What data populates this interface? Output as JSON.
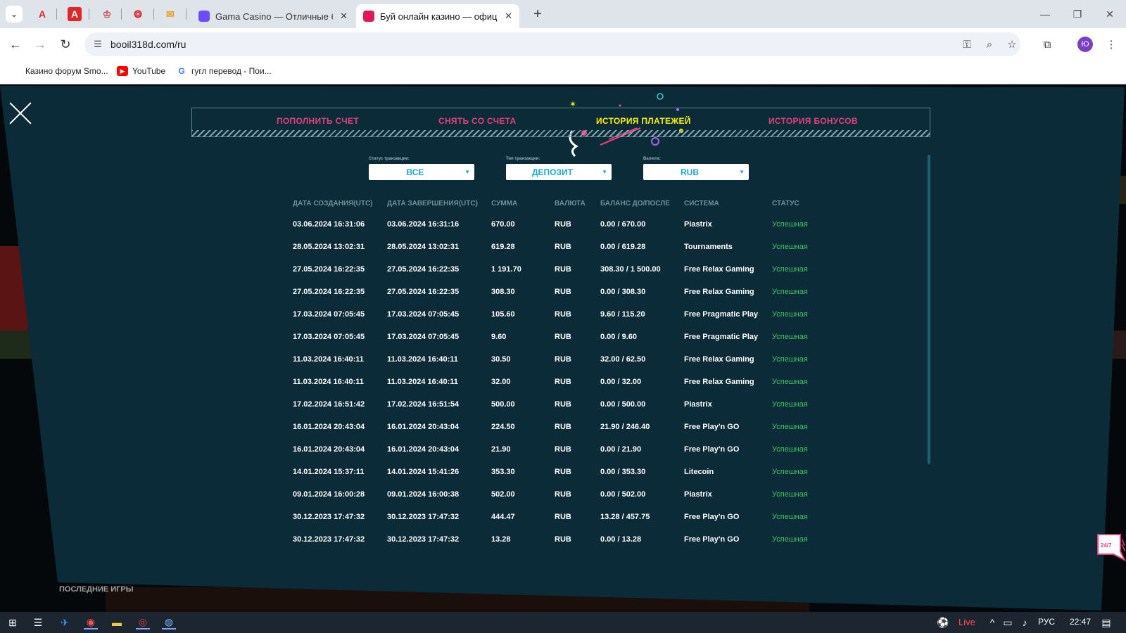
{
  "browser": {
    "pinned": [
      {
        "name": "acrobat",
        "glyph": "A",
        "color": "#e0262b"
      },
      {
        "name": "adobe",
        "glyph": "A",
        "color": "#ffffff",
        "bg": "#e0262b"
      },
      {
        "name": "crown",
        "glyph": "♔",
        "color": "#d7464c"
      },
      {
        "name": "gear",
        "glyph": "❂",
        "color": "#e0262b"
      },
      {
        "name": "mail",
        "glyph": "✉",
        "color": "#e8a21a"
      }
    ],
    "tabs": [
      {
        "title": "Gama Casino — Отличные бо",
        "fav_color": "#6d4cff",
        "close": "✕"
      },
      {
        "title": "Буй онлайн казино — официа",
        "fav_color": "#e0195b",
        "close": "✕"
      }
    ],
    "new_tab": "+",
    "window": {
      "minimize": "—",
      "restore": "❐",
      "close": "✕"
    },
    "nav": {
      "back": "←",
      "forward": "→",
      "reload": "↻"
    },
    "url": "booil318d.com/ru",
    "profile_letter": "Ю",
    "bookmarks": [
      {
        "label": "Казино форум Smo...",
        "icon_color": "#3a3a3a",
        "glyph": ""
      },
      {
        "label": "YouTube",
        "icon_color": "#ff0000",
        "glyph": "▶"
      },
      {
        "label": "гугл перевод - Пои...",
        "icon_color": "#4285f4",
        "glyph": "G"
      }
    ]
  },
  "modal": {
    "tabs": [
      {
        "label": "ПОПОЛНИТЬ СЧЕТ",
        "color": "#e0407e"
      },
      {
        "label": "СНЯТЬ СО СЧЕТА",
        "color": "#e0407e"
      },
      {
        "label": "ИСТОРИЯ ПЛАТЕЖЕЙ",
        "color": "#fff200"
      },
      {
        "label": "ИСТОРИЯ БОНУСОВ",
        "color": "#e0407e"
      }
    ],
    "filters": [
      {
        "label": "Статус транзакции:",
        "value": "ВСЕ"
      },
      {
        "label": "Тип транзакции:",
        "value": "ДЕПОЗИТ"
      },
      {
        "label": "Валюта:",
        "value": "RUB"
      }
    ],
    "columns": [
      "ДАТА СОЗДАНИЯ(UTC)",
      "ДАТА ЗАВЕРШЕНИЯ(UTC)",
      "СУММА",
      "ВАЛЮТА",
      "БАЛАНС ДО/ПОСЛЕ",
      "СИСТЕМА",
      "СТАТУС"
    ],
    "rows": [
      [
        "03.06.2024 16:31:06",
        "03.06.2024 16:31:16",
        "670.00",
        "RUB",
        "0.00 / 670.00",
        "Piastrix",
        "Успешная"
      ],
      [
        "28.05.2024 13:02:31",
        "28.05.2024 13:02:31",
        "619.28",
        "RUB",
        "0.00 / 619.28",
        "Tournaments",
        "Успешная"
      ],
      [
        "27.05.2024 16:22:35",
        "27.05.2024 16:22:35",
        "1 191.70",
        "RUB",
        "308.30 / 1 500.00",
        "Free Relax Gaming",
        "Успешная"
      ],
      [
        "27.05.2024 16:22:35",
        "27.05.2024 16:22:35",
        "308.30",
        "RUB",
        "0.00 / 308.30",
        "Free Relax Gaming",
        "Успешная"
      ],
      [
        "17.03.2024 07:05:45",
        "17.03.2024 07:05:45",
        "105.60",
        "RUB",
        "9.60 / 115.20",
        "Free Pragmatic Play",
        "Успешная"
      ],
      [
        "17.03.2024 07:05:45",
        "17.03.2024 07:05:45",
        "9.60",
        "RUB",
        "0.00 / 9.60",
        "Free Pragmatic Play",
        "Успешная"
      ],
      [
        "11.03.2024 16:40:11",
        "11.03.2024 16:40:11",
        "30.50",
        "RUB",
        "32.00 / 62.50",
        "Free Relax Gaming",
        "Успешная"
      ],
      [
        "11.03.2024 16:40:11",
        "11.03.2024 16:40:11",
        "32.00",
        "RUB",
        "0.00 / 32.00",
        "Free Relax Gaming",
        "Успешная"
      ],
      [
        "17.02.2024 16:51:42",
        "17.02.2024 16:51:54",
        "500.00",
        "RUB",
        "0.00 / 500.00",
        "Piastrix",
        "Успешная"
      ],
      [
        "16.01.2024 20:43:04",
        "16.01.2024 20:43:04",
        "224.50",
        "RUB",
        "21.90 / 246.40",
        "Free Play'n GO",
        "Успешная"
      ],
      [
        "16.01.2024 20:43:04",
        "16.01.2024 20:43:04",
        "21.90",
        "RUB",
        "0.00 / 21.90",
        "Free Play'n GO",
        "Успешная"
      ],
      [
        "14.01.2024 15:37:11",
        "14.01.2024 15:41:26",
        "353.30",
        "RUB",
        "0.00 / 353.30",
        "Litecoin",
        "Успешная"
      ],
      [
        "09.01.2024 16:00:28",
        "09.01.2024 16:00:38",
        "502.00",
        "RUB",
        "0.00 / 502.00",
        "Piastrix",
        "Успешная"
      ],
      [
        "30.12.2023 17:47:32",
        "30.12.2023 17:47:32",
        "444.47",
        "RUB",
        "13.28 / 457.75",
        "Free Play'n GO",
        "Успешная"
      ],
      [
        "30.12.2023 17:47:32",
        "30.12.2023 17:47:32",
        "13.28",
        "RUB",
        "0.00 / 13.28",
        "Free Play'n GO",
        "Успешная"
      ]
    ],
    "support_label": "24/7"
  },
  "page": {
    "recent_games_label": "ПОСЛЕДНИЕ ИГРЫ"
  },
  "taskbar": {
    "live_label": "Live",
    "lang": "РУС",
    "time": "22:47"
  }
}
